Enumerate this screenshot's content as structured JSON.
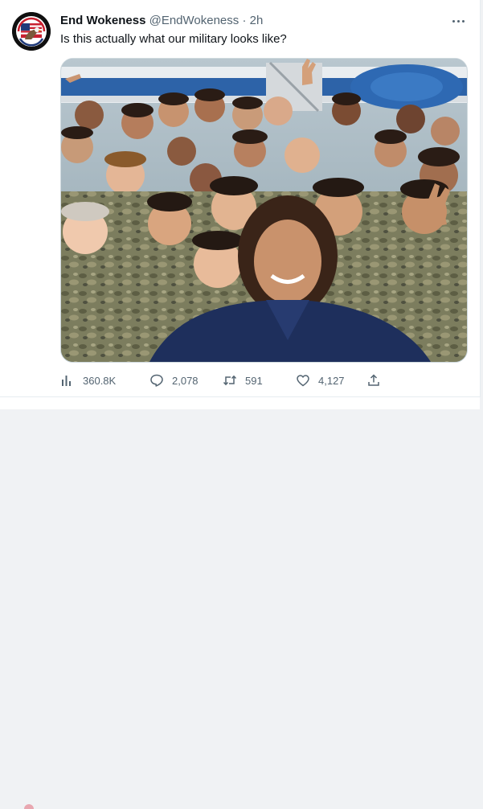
{
  "tweet": {
    "display_name": "End Wokeness",
    "handle": "@EndWokeness",
    "separator": "·",
    "time": "2h",
    "text": "Is this actually what our military looks like?",
    "avatar_icon": "eagle-flag-badge-icon",
    "media_alt": "Group selfie with uniformed service members in front of an aircraft"
  },
  "actions": {
    "views": {
      "icon": "bar-chart-icon",
      "count": "360.8K"
    },
    "replies": {
      "icon": "comment-icon",
      "count": "2,078"
    },
    "retweets": {
      "icon": "retweet-icon",
      "count": "591"
    },
    "likes": {
      "icon": "heart-icon",
      "count": "4,127"
    },
    "share": {
      "icon": "share-icon"
    }
  },
  "colors": {
    "text_primary": "#0f1419",
    "text_secondary": "#536471",
    "border": "#cfd9de",
    "background": "#ffffff"
  }
}
